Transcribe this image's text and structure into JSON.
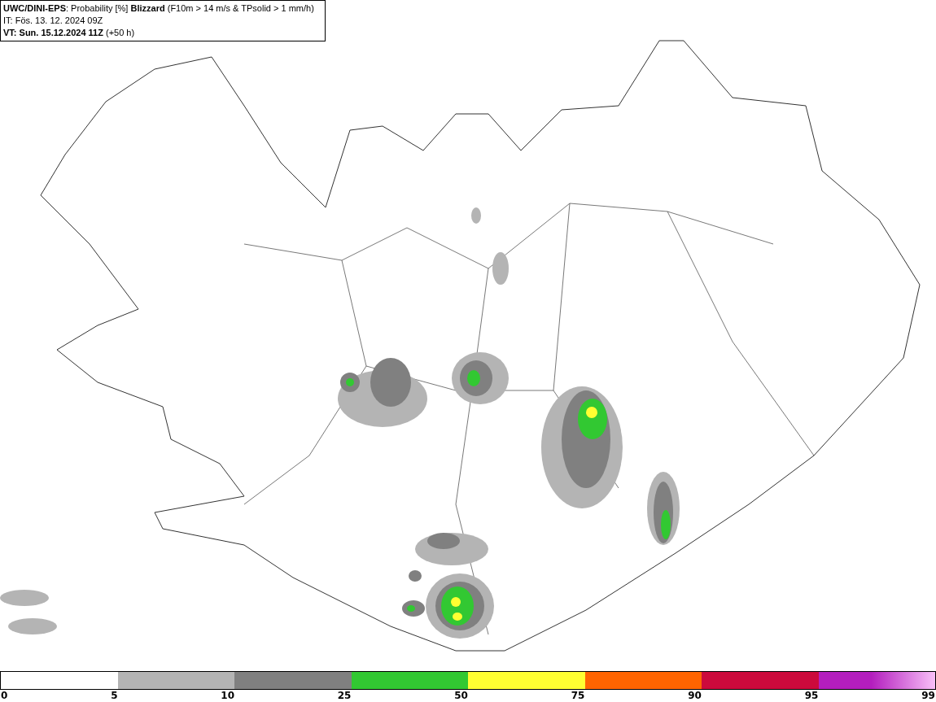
{
  "header": {
    "lines": [
      "**UWC/DINI-EPS**: Probability [%] **Blizzard** (F10m > 14 m/s & TPsolid > 1 mm/h)",
      "IT: Fös. 13. 12. 2024 09Z",
      "**VT: Sun. 15.12.2024 11Z** (+50 h)"
    ]
  },
  "colorbar": {
    "segments": [
      {
        "kind": "solid",
        "color": "#b4b4b4"
      },
      {
        "kind": "solid",
        "color": "#808080"
      },
      {
        "kind": "solid",
        "color": "#32c832"
      },
      {
        "kind": "solid",
        "color": "#ffff32"
      },
      {
        "kind": "solid",
        "color": "#ff6400"
      },
      {
        "kind": "solid",
        "color": "#cc0a3c"
      },
      {
        "kind": "gradient",
        "color": "#b41ebe"
      }
    ],
    "ticks": [
      "0",
      "5",
      "10",
      "25",
      "50",
      "75",
      "90",
      "95",
      "99"
    ]
  }
}
